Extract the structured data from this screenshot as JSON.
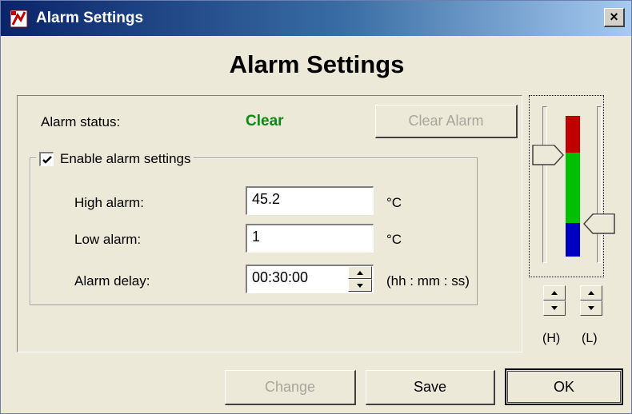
{
  "window": {
    "title": "Alarm Settings",
    "close_label": "×"
  },
  "heading": "Alarm Settings",
  "status": {
    "label": "Alarm status:",
    "value": "Clear",
    "value_color": "#0a8a12",
    "clear_button": "Clear Alarm"
  },
  "alarm_group": {
    "enable_label": "Enable alarm settings",
    "enabled": true,
    "high": {
      "label": "High alarm:",
      "value": "45.2",
      "unit": "°C"
    },
    "low": {
      "label": "Low alarm:",
      "value": "1",
      "unit": "°C"
    },
    "delay": {
      "label": "Alarm delay:",
      "value": "00:30:00",
      "unit": "(hh : mm : ss)"
    }
  },
  "sliders": {
    "high_label": "(H)",
    "low_label": "(L)",
    "band_colors": {
      "high": "#c00000",
      "normal": "#00c000",
      "low": "#0000c0"
    }
  },
  "footer": {
    "change_button": "Change",
    "save_button": "Save",
    "ok_button": "OK"
  },
  "icons": {
    "window_icon": "alarm-app-icon",
    "checkbox_icon": "checkmark-icon",
    "spinner_up": "arrow-up-icon",
    "spinner_down": "arrow-down-icon"
  }
}
